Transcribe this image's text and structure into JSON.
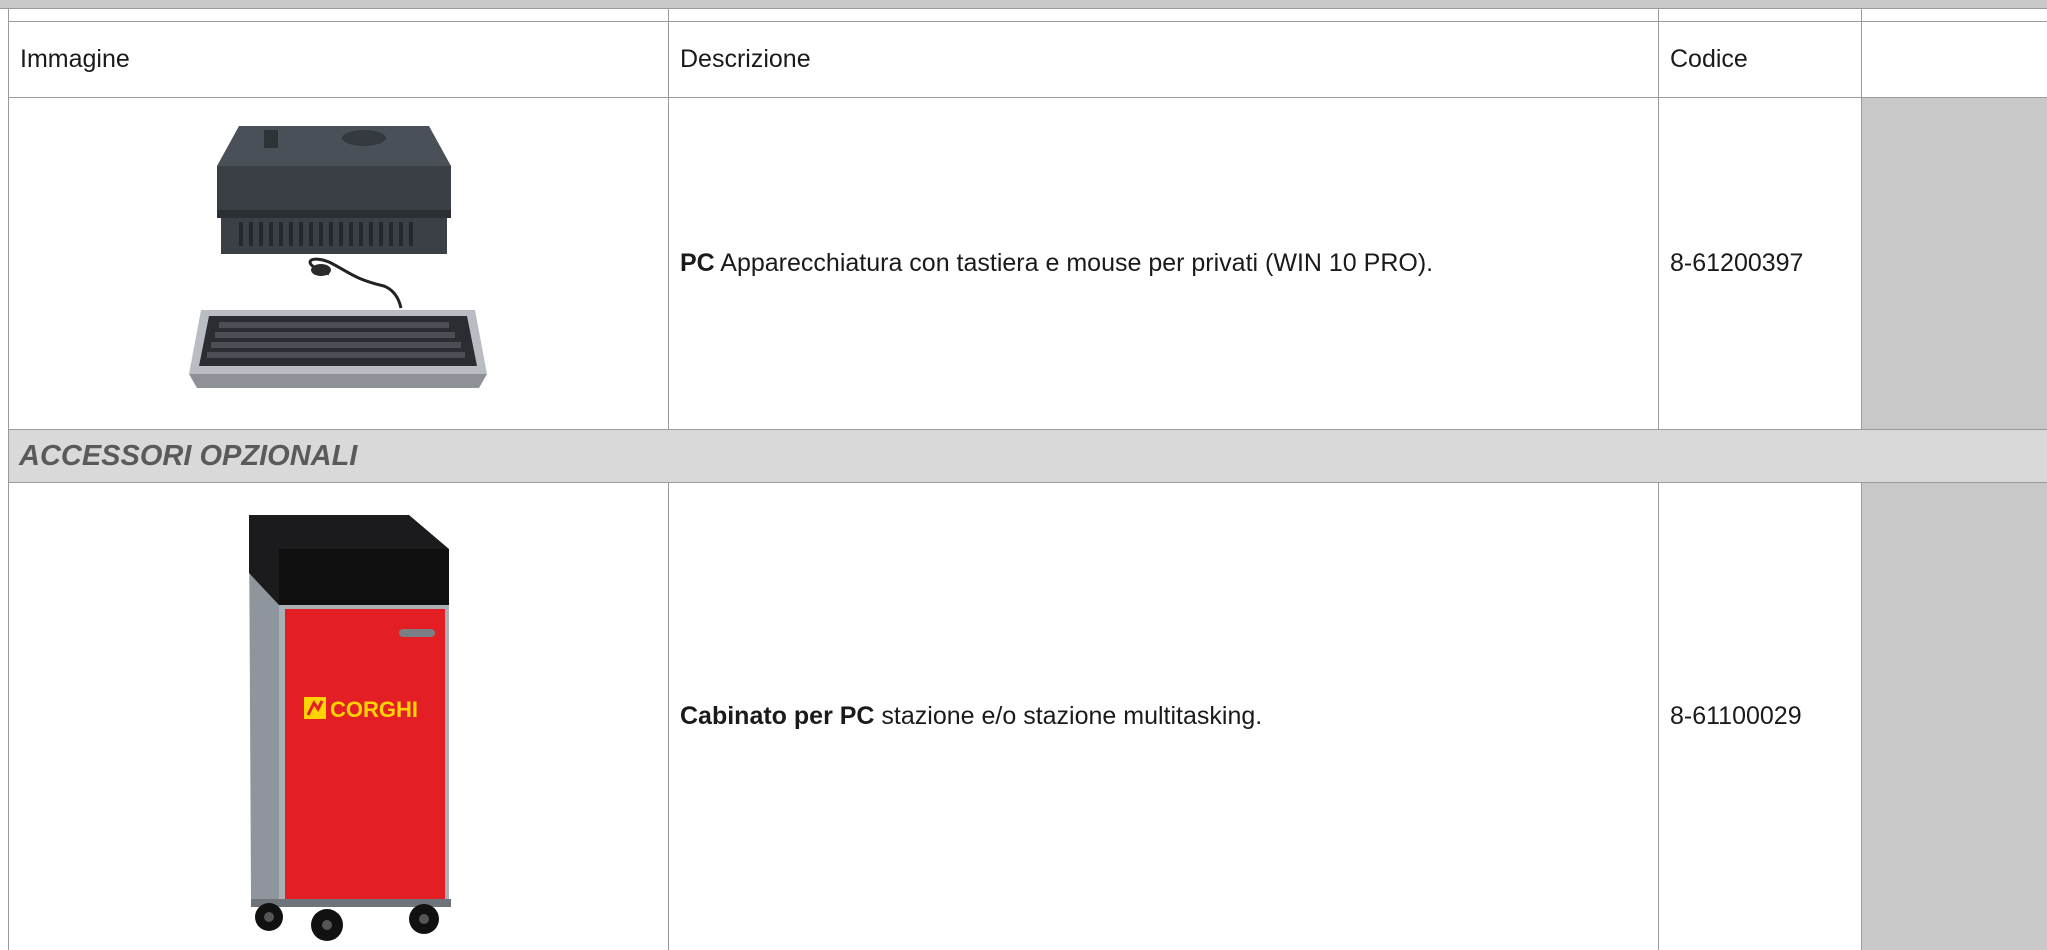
{
  "table": {
    "headers": {
      "image": "Immagine",
      "description": "Descrizione",
      "code": "Codice",
      "extra": ""
    },
    "section_title": "ACCESSORI OPZIONALI",
    "rows": [
      {
        "image_icon": "pc-tower-with-keyboard",
        "desc_bold": "PC",
        "desc_rest": " Apparecchiatura con tastiera e mouse per privati (WIN 10 PRO).",
        "code": "8-61200397"
      },
      {
        "image_icon": "pc-cabinet-cart",
        "logo_text": "CORGHI",
        "desc_bold": "Cabinato per PC",
        "desc_rest": " stazione e/o stazione multitasking.",
        "code": "8-61100029"
      }
    ]
  },
  "colors": {
    "cabinet_red": "#e31e24",
    "logo_yellow": "#ffd400",
    "section_bg": "#d9d9d9",
    "gray_column": "#c8c8c8"
  }
}
